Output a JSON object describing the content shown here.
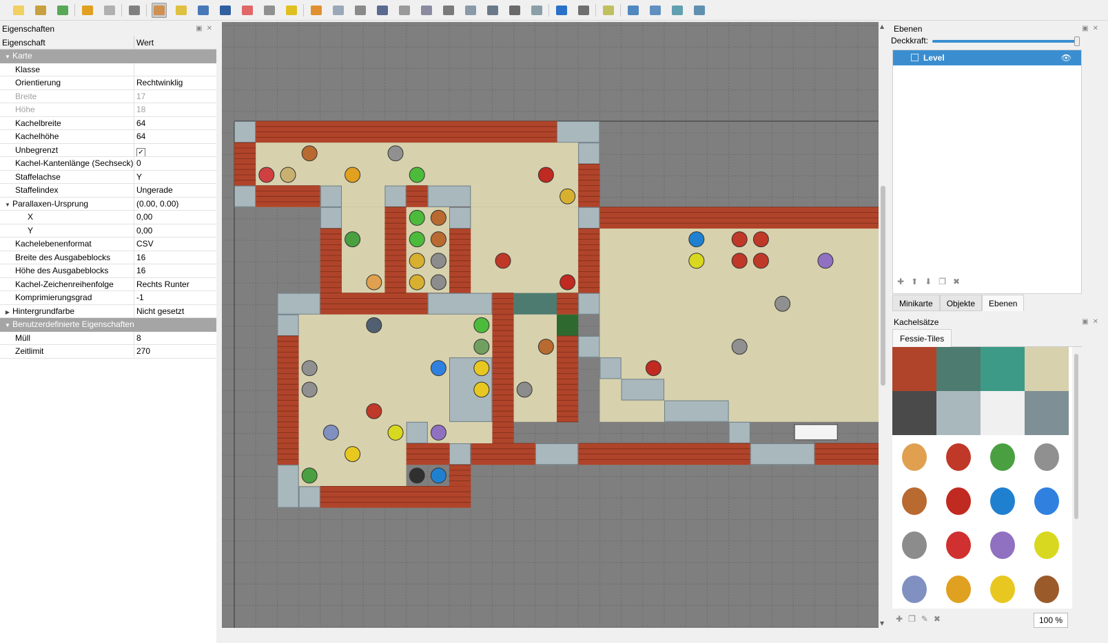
{
  "toolbar": {
    "buttons": [
      "new-file-icon",
      "open-file-icon",
      "save-file-icon",
      "undo-icon",
      "redo-icon",
      "commands-icon",
      "stamp-brush-icon",
      "terrain-brush-icon",
      "bucket-fill-icon",
      "shape-fill-icon",
      "eraser-icon",
      "rect-select-icon",
      "magic-wand-icon",
      "select-same-tile-icon",
      "select-objects-icon",
      "edit-polygons-icon",
      "insert-rectangle-icon",
      "insert-point-icon",
      "insert-ellipse-icon",
      "insert-polygon-icon",
      "insert-tile-icon",
      "insert-template-icon",
      "insert-text-icon",
      "layer-offset-icon",
      "world-tool-icon",
      "random-mode-icon",
      "wang-fill-icon",
      "flip-horizontal-icon",
      "flip-vertical-icon",
      "rotate-left-icon",
      "rotate-right-icon"
    ],
    "active": "stamp-brush-icon"
  },
  "properties_panel": {
    "title": "Eigenschaften",
    "col_key": "Eigenschaft",
    "col_value": "Wert",
    "rows": [
      {
        "key": "Karte",
        "value": "",
        "type": "group"
      },
      {
        "key": "Klasse",
        "value": "",
        "type": "normal"
      },
      {
        "key": "Orientierung",
        "value": "Rechtwinklig",
        "type": "normal"
      },
      {
        "key": "Breite",
        "value": "17",
        "type": "readonly"
      },
      {
        "key": "Höhe",
        "value": "18",
        "type": "readonly"
      },
      {
        "key": "Kachelbreite",
        "value": "64",
        "type": "normal"
      },
      {
        "key": "Kachelhöhe",
        "value": "64",
        "type": "normal"
      },
      {
        "key": "Unbegrenzt",
        "value": "✓",
        "type": "check"
      },
      {
        "key": "Kachel-Kantenlänge (Sechseck)",
        "value": "0",
        "type": "normal"
      },
      {
        "key": "Staffelachse",
        "value": "Y",
        "type": "normal"
      },
      {
        "key": "Staffelindex",
        "value": "Ungerade",
        "type": "normal"
      },
      {
        "key": "Parallaxen-Ursprung",
        "value": "(0.00, 0.00)",
        "type": "expandable"
      },
      {
        "key": "X",
        "value": "0,00",
        "type": "sub"
      },
      {
        "key": "Y",
        "value": "0,00",
        "type": "sub"
      },
      {
        "key": "Kachelebenenformat",
        "value": "CSV",
        "type": "normal"
      },
      {
        "key": "Breite des Ausgabeblocks",
        "value": "16",
        "type": "normal"
      },
      {
        "key": "Höhe des Ausgabeblocks",
        "value": "16",
        "type": "normal"
      },
      {
        "key": "Kachel-Zeichenreihenfolge",
        "value": "Rechts Runter",
        "type": "normal"
      },
      {
        "key": "Komprimierungsgrad",
        "value": "-1",
        "type": "normal"
      },
      {
        "key": "Hintergrundfarbe",
        "value": "Nicht gesetzt",
        "type": "collapsed"
      },
      {
        "key": "Benutzerdefinierte Eigenschaften",
        "value": "",
        "type": "group"
      },
      {
        "key": "Müll",
        "value": "8",
        "type": "normal"
      },
      {
        "key": "Zeitlimit",
        "value": "270",
        "type": "normal"
      }
    ]
  },
  "layers_panel": {
    "title": "Ebenen",
    "opacity_label": "Deckkraft:",
    "layer_name": "Level"
  },
  "tabs": [
    "Minikarte",
    "Objekte",
    "Ebenen"
  ],
  "selected_tab": "Ebenen",
  "tilesets_panel": {
    "title": "Kachelsätze",
    "tab": "Fessie-Tiles",
    "zoom": "100 %"
  },
  "colors": {
    "brick": "#b0442a",
    "floor": "#d7d1ad",
    "metal": "#a9b8bd",
    "canvas": "#7f7f7f",
    "selection": "#3a8ed0"
  }
}
